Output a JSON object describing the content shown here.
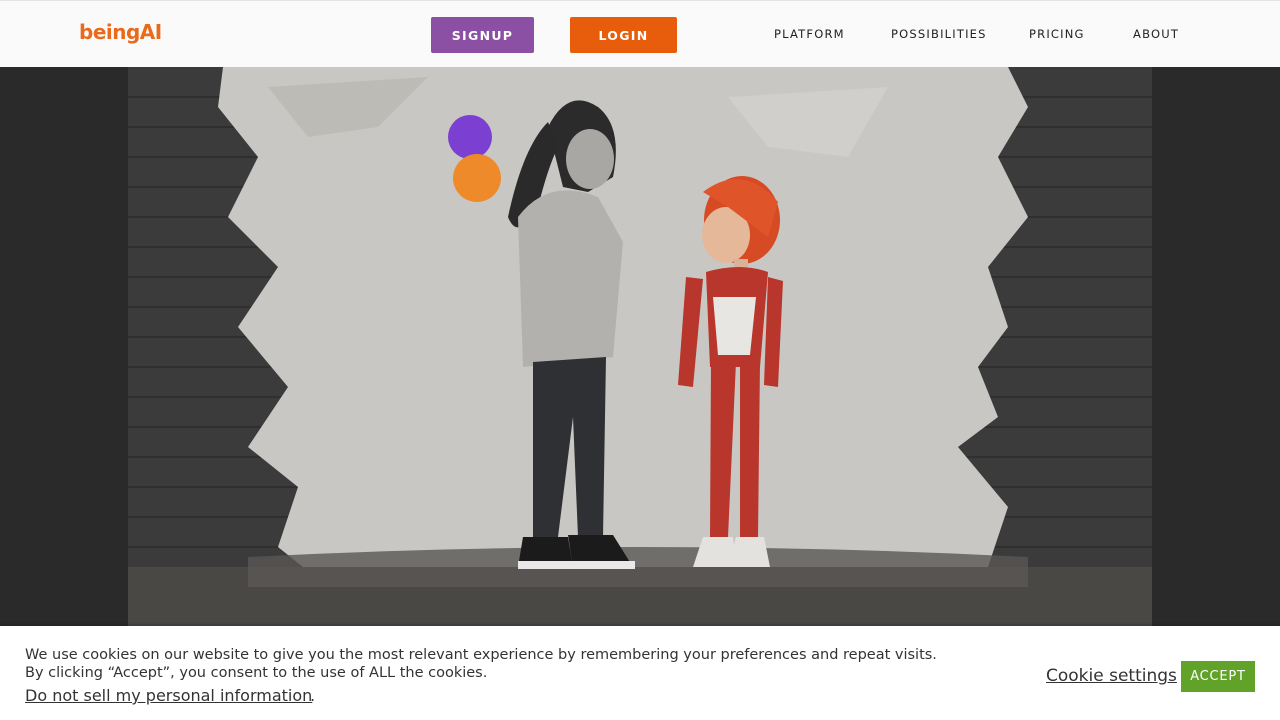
{
  "header": {
    "logo_text": "beingAI",
    "signup_label": "SIGNUP",
    "login_label": "LOGIN",
    "nav": {
      "platform": "PLATFORM",
      "possibilities": "POSSIBILITIES",
      "pricing": "PRICING",
      "about": "ABOUT"
    }
  },
  "colors": {
    "brand_orange": "#e85d0c",
    "signup_purple": "#8b4fa3",
    "accept_green": "#61a229",
    "page_dark": "#2a2a2a"
  },
  "cookie_banner": {
    "line1": "We use cookies on our website to give you the most relevant experience by remembering your preferences and repeat visits.",
    "line2": "By clicking “Accept”, you consent to the use of ALL the cookies.",
    "do_not_sell": "Do not sell my personal information",
    "period": ".",
    "settings_label": "Cookie settings",
    "accept_label": "ACCEPT"
  }
}
